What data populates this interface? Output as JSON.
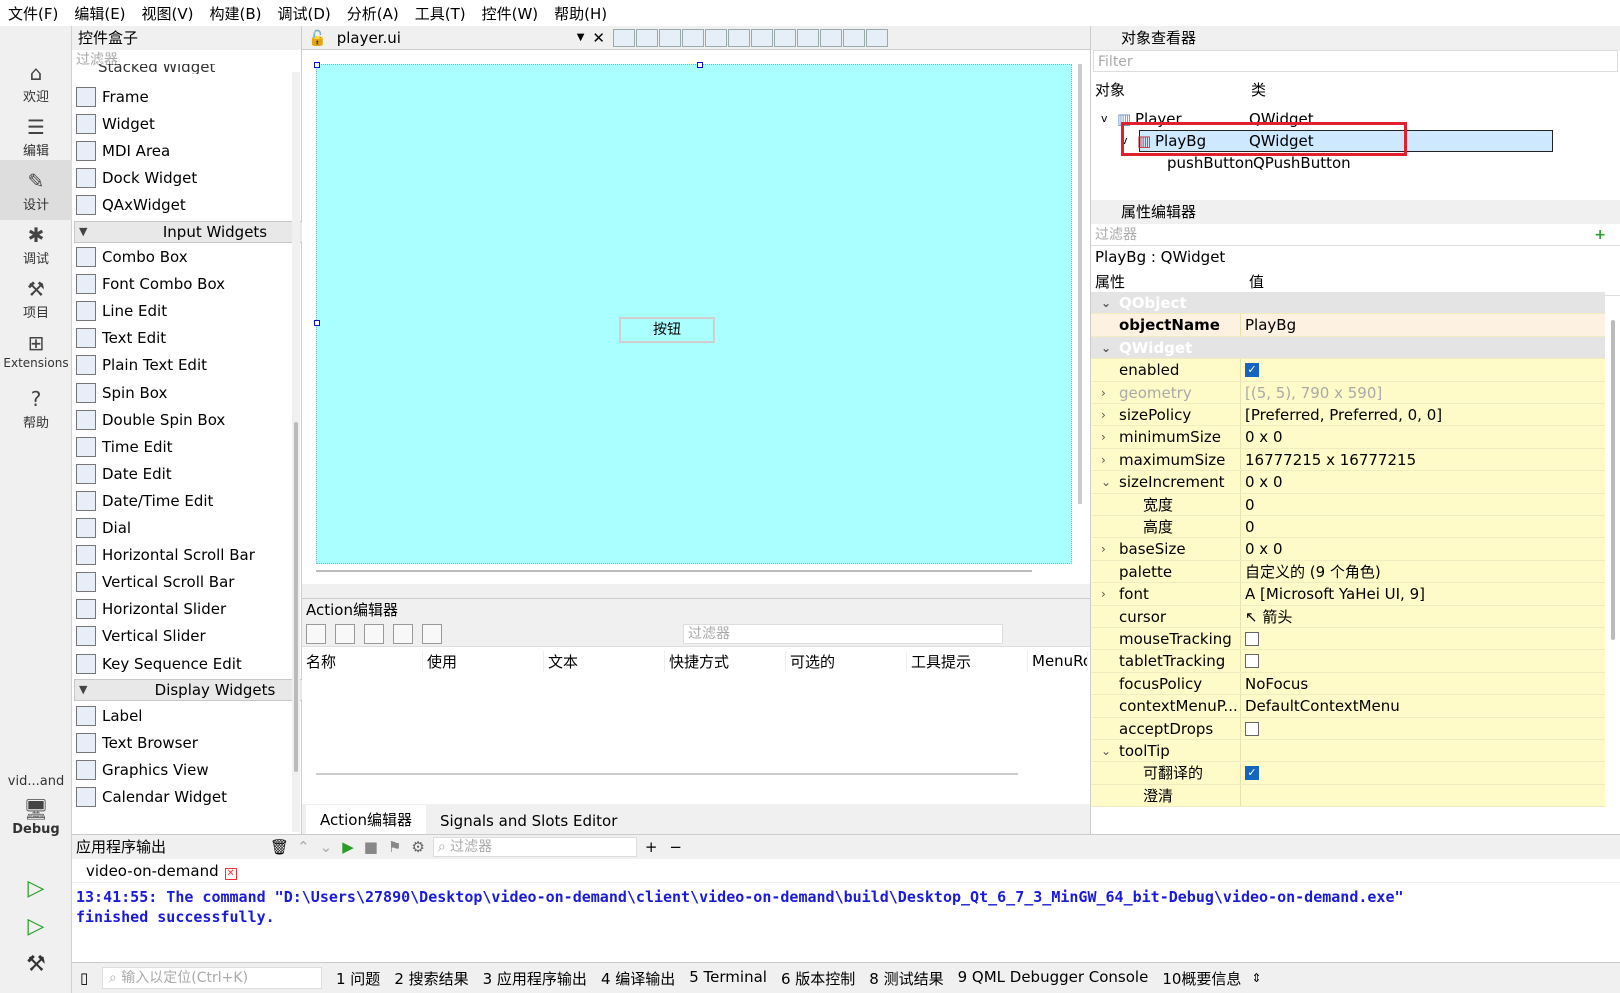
{
  "menubar": [
    "文件(F)",
    "编辑(E)",
    "视图(V)",
    "构建(B)",
    "调试(D)",
    "分析(A)",
    "工具(T)",
    "控件(W)",
    "帮助(H)"
  ],
  "modes": [
    {
      "label": "欢迎",
      "icon": "home-icon"
    },
    {
      "label": "编辑",
      "icon": "edit-icon"
    },
    {
      "label": "设计",
      "icon": "design-icon"
    },
    {
      "label": "调试",
      "icon": "debug-icon"
    },
    {
      "label": "项目",
      "icon": "project-icon"
    },
    {
      "label": "Extensions",
      "icon": "extensions-icon"
    },
    {
      "label": "帮助",
      "icon": "help-icon"
    }
  ],
  "kit": {
    "project": "vid...and",
    "label": "Debug"
  },
  "widget_box": {
    "title": "控件盒子",
    "filter_placeholder": "过滤器",
    "partial_item": "Stacked Widget",
    "containers": [
      "Frame",
      "Widget",
      "MDI Area",
      "Dock Widget",
      "QAxWidget"
    ],
    "input_category": "Input Widgets",
    "input_items": [
      "Combo Box",
      "Font Combo Box",
      "Line Edit",
      "Text Edit",
      "Plain Text Edit",
      "Spin Box",
      "Double Spin Box",
      "Time Edit",
      "Date Edit",
      "Date/Time Edit",
      "Dial",
      "Horizontal Scroll Bar",
      "Vertical Scroll Bar",
      "Horizontal Slider",
      "Vertical Slider",
      "Key Sequence Edit"
    ],
    "display_category": "Display Widgets",
    "display_items": [
      "Label",
      "Text Browser",
      "Graphics View",
      "Calendar Widget"
    ]
  },
  "editor": {
    "file": "player.ui",
    "button_text": "按钮"
  },
  "action_editor": {
    "title": "Action编辑器",
    "filter_placeholder": "过滤器",
    "columns": [
      "名称",
      "使用",
      "文本",
      "快捷方式",
      "可选的",
      "工具提示",
      "MenuRo"
    ],
    "tabs": [
      "Action编辑器",
      "Signals and Slots Editor"
    ]
  },
  "object_inspector": {
    "title": "对象查看器",
    "filter_placeholder": "Filter",
    "col_object": "对象",
    "col_class": "类",
    "rows": [
      {
        "object": "Player",
        "class": "QWidget"
      },
      {
        "object": "PlayBg",
        "class": "QWidget"
      },
      {
        "object": "pushButton",
        "class": "QPushButton"
      }
    ]
  },
  "property_editor": {
    "title": "属性编辑器",
    "filter_placeholder": "过滤器",
    "class_label": "PlayBg : QWidget",
    "col_prop": "属性",
    "col_value": "值",
    "rows": [
      {
        "name": "QObject",
        "value": "",
        "kind": "group"
      },
      {
        "name": "objectName",
        "value": "PlayBg",
        "kind": "hl"
      },
      {
        "name": "QWidget",
        "value": "",
        "kind": "group"
      },
      {
        "name": "enabled",
        "value": "",
        "kind": "check-on"
      },
      {
        "name": "geometry",
        "value": "[(5, 5), 790 x 590]",
        "kind": "dim-exp"
      },
      {
        "name": "sizePolicy",
        "value": "[Preferred, Preferred, 0, 0]",
        "kind": "exp"
      },
      {
        "name": "minimumSize",
        "value": "0 x 0",
        "kind": "exp"
      },
      {
        "name": "maximumSize",
        "value": "16777215 x 16777215",
        "kind": "exp"
      },
      {
        "name": "sizeIncrement",
        "value": "0 x 0",
        "kind": "open"
      },
      {
        "name": "宽度",
        "value": "0",
        "kind": "sub"
      },
      {
        "name": "高度",
        "value": "0",
        "kind": "sub"
      },
      {
        "name": "baseSize",
        "value": "0 x 0",
        "kind": "exp"
      },
      {
        "name": "palette",
        "value": "自定义的 (9 个角色)",
        "kind": "plain"
      },
      {
        "name": "font",
        "value": "A  [Microsoft YaHei UI, 9]",
        "kind": "exp"
      },
      {
        "name": "cursor",
        "value": "↖  箭头",
        "kind": "plain"
      },
      {
        "name": "mouseTracking",
        "value": "",
        "kind": "check-off"
      },
      {
        "name": "tabletTracking",
        "value": "",
        "kind": "check-off"
      },
      {
        "name": "focusPolicy",
        "value": "NoFocus",
        "kind": "plain"
      },
      {
        "name": "contextMenuP...",
        "value": "DefaultContextMenu",
        "kind": "plain"
      },
      {
        "name": "acceptDrops",
        "value": "",
        "kind": "check-off"
      },
      {
        "name": "toolTip",
        "value": "",
        "kind": "open"
      },
      {
        "name": "可翻译的",
        "value": "",
        "kind": "sub-check-on"
      },
      {
        "name": "澄清",
        "value": "",
        "kind": "sub"
      }
    ]
  },
  "output": {
    "title": "应用程序输出",
    "filter_placeholder": "过滤器",
    "tab": "video-on-demand",
    "line1": "13:41:55: The command \"D:\\Users\\27890\\Desktop\\video-on-demand\\client\\video-on-demand\\build\\Desktop_Qt_6_7_3_MinGW_64_bit-Debug\\video-on-demand.exe\"",
    "line2": "finished successfully."
  },
  "statusbar": {
    "locator_placeholder": "输入以定位(Ctrl+K)",
    "items": [
      "1 问题",
      "2 搜索结果",
      "3 应用程序输出",
      "4 编译输出",
      "5 Terminal",
      "6 版本控制",
      "8 测试结果",
      "9 QML Debugger Console",
      "10概要信息"
    ]
  }
}
